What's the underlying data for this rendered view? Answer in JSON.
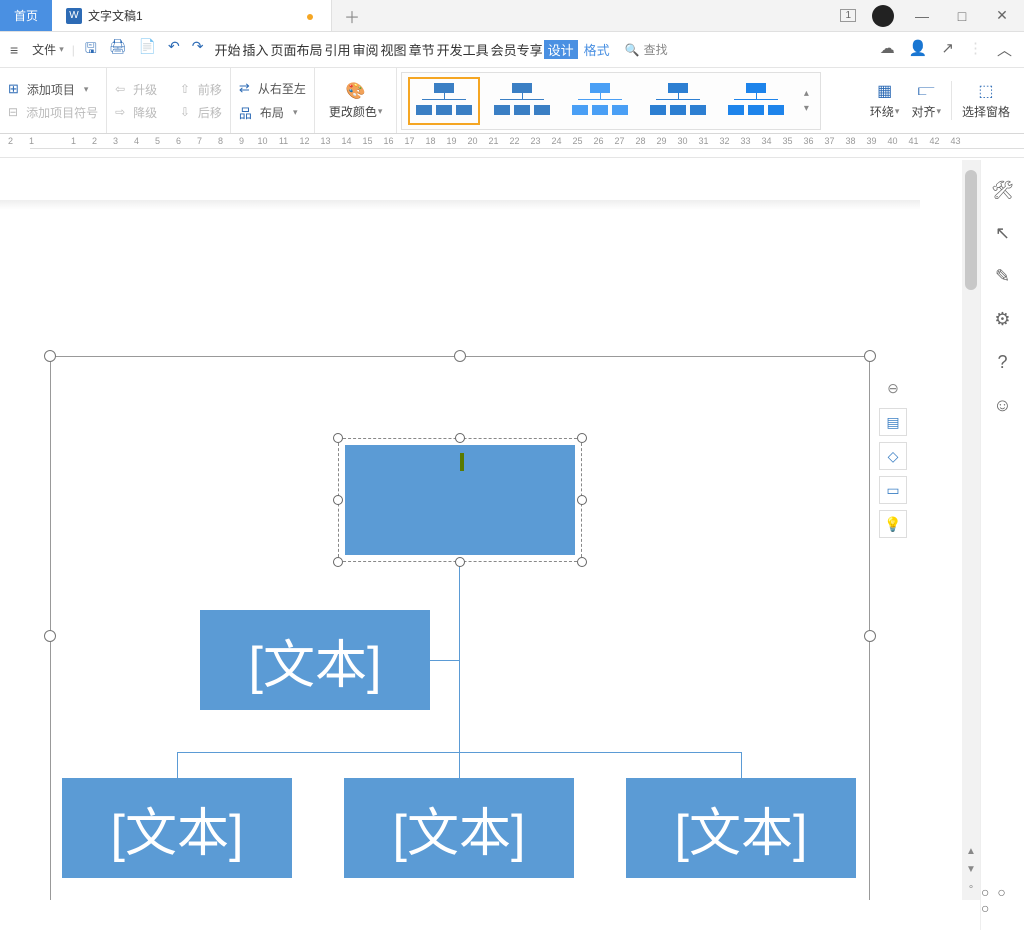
{
  "tabs": {
    "home": "首页",
    "doc": "文字文稿1",
    "window_count": "1"
  },
  "window": {
    "min": "—",
    "max": "□",
    "close": "✕"
  },
  "file_label": "文件",
  "menu": {
    "items": [
      "开始",
      "插入",
      "页面布局",
      "引用",
      "审阅",
      "视图",
      "章节",
      "开发工具",
      "会员专享",
      "设计",
      "格式"
    ],
    "active_index": 9
  },
  "search": {
    "label": "查找"
  },
  "ribbon": {
    "add_item": "添加项目",
    "add_bullet": "添加项目符号",
    "promote": "升级",
    "demote": "降级",
    "move_fwd": "前移",
    "move_back": "后移",
    "rtl": "从右至左",
    "layout": "布局",
    "change_color": "更改颜色",
    "wrap": "环绕",
    "align": "对齐",
    "select_pane": "选择窗格"
  },
  "smartart": {
    "root": "",
    "assistant": "[文本]",
    "children": [
      "[文本]",
      "[文本]",
      "[文本]"
    ]
  },
  "ruler_nums": [
    "2",
    "1",
    "",
    "1",
    "2",
    "3",
    "4",
    "5",
    "6",
    "7",
    "8",
    "9",
    "10",
    "11",
    "12",
    "13",
    "14",
    "15",
    "16",
    "17",
    "18",
    "19",
    "20",
    "21",
    "22",
    "23",
    "24",
    "25",
    "26",
    "27",
    "28",
    "29",
    "30",
    "31",
    "32",
    "33",
    "34",
    "35",
    "36",
    "37",
    "38",
    "39",
    "40",
    "41",
    "42",
    "43"
  ]
}
